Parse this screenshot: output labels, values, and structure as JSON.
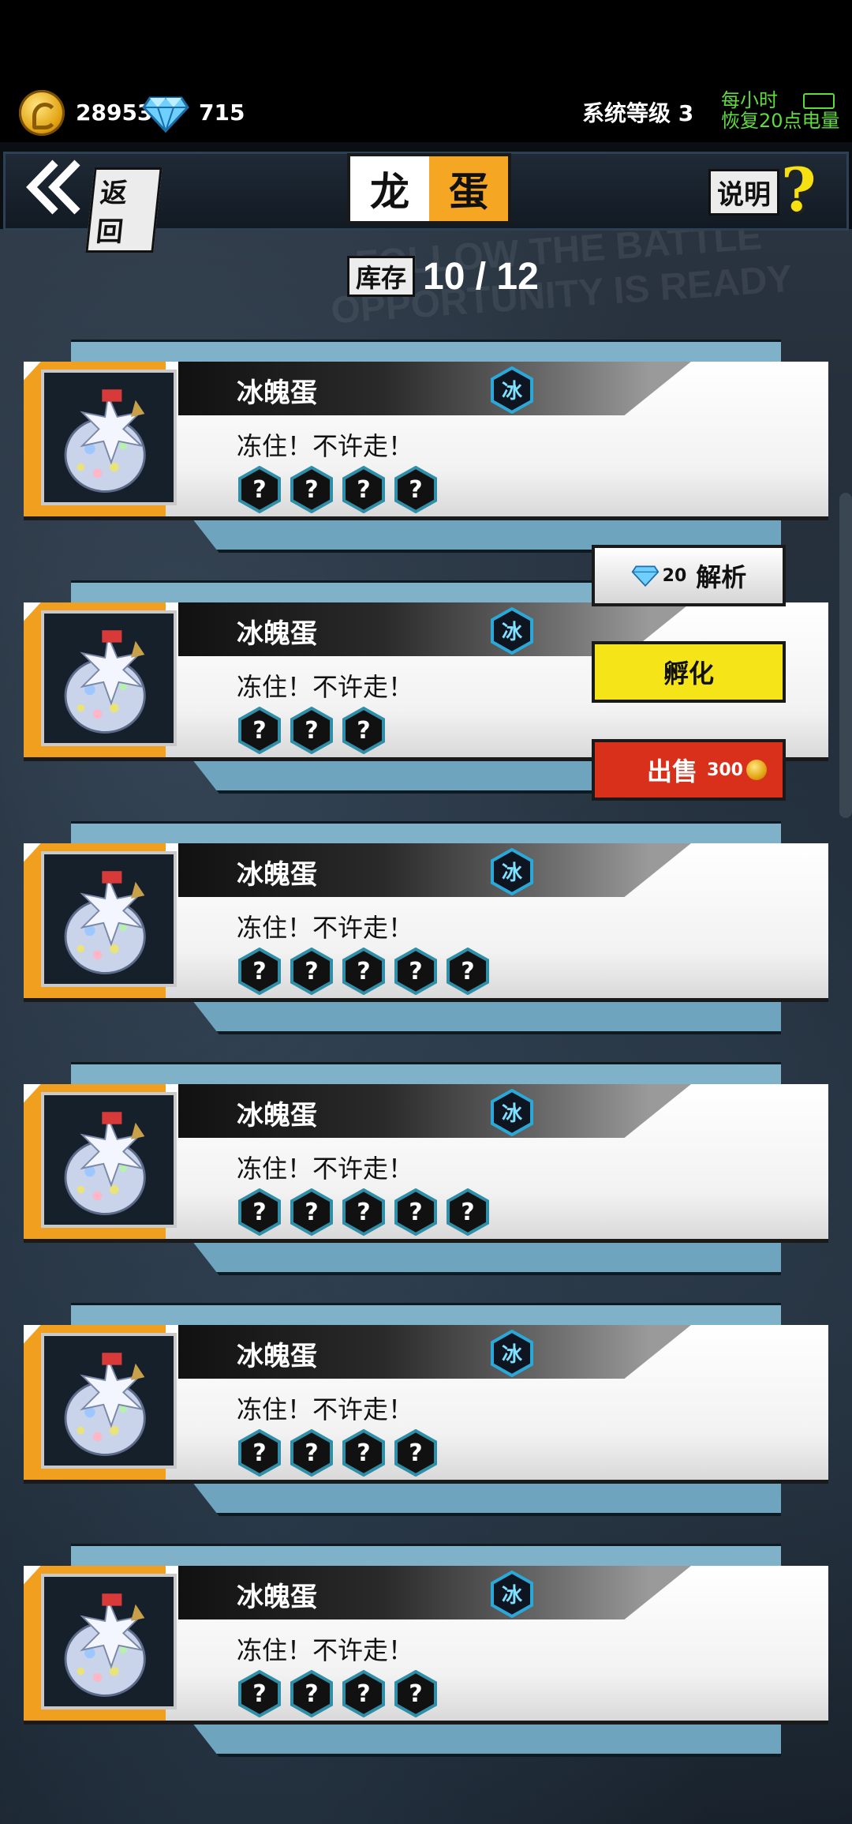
{
  "currency": {
    "coins": "28953",
    "gems": "715"
  },
  "system": {
    "level_label": "系统等级 3",
    "recover_line1": "每小时",
    "recover_line2": "恢复20点电量"
  },
  "header": {
    "back_label": "返回",
    "title_part1": "龙",
    "title_part2": "蛋",
    "help_label": "说明",
    "help_symbol": "?"
  },
  "inventory": {
    "label": "库存",
    "value": "10 / 12"
  },
  "element_icon_text": "冰",
  "slot_symbol": "?",
  "eggs": [
    {
      "name": "冰魄蛋",
      "desc": "冻住！不许走！",
      "slots": 4
    },
    {
      "name": "冰魄蛋",
      "desc": "冻住！不许走！",
      "slots": 3
    },
    {
      "name": "冰魄蛋",
      "desc": "冻住！不许走！",
      "slots": 5
    },
    {
      "name": "冰魄蛋",
      "desc": "冻住！不许走！",
      "slots": 5
    },
    {
      "name": "冰魄蛋",
      "desc": "冻住！不许走！",
      "slots": 4
    },
    {
      "name": "冰魄蛋",
      "desc": "冻住！不许走！",
      "slots": 4
    }
  ],
  "menu": {
    "analyze_cost": "20",
    "analyze_label": "解析",
    "hatch_label": "孵化",
    "sell_label": "出售",
    "sell_price": "300"
  },
  "bg_text": [
    "FOLLOW THE BATTLE",
    "OPPORTUNITY IS READY"
  ],
  "colors": {
    "accent_orange": "#f0a01e",
    "hatch_yellow": "#f4e418",
    "sell_red": "#d9301c",
    "recover_green": "#5fdc3c"
  }
}
